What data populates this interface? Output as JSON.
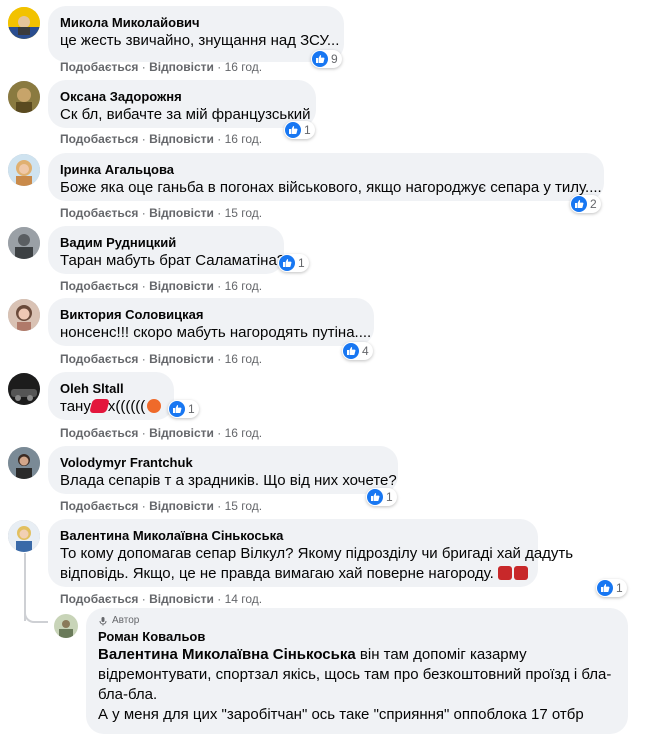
{
  "comments": [
    {
      "name": "Микола Миколайович",
      "text": "це жесть звичайно, знущання над ЗСУ...",
      "actions": {
        "like": "Подобається",
        "reply": "Відповісти",
        "time": "16 год."
      },
      "reactions": "9",
      "avatar_color": "#f2c200"
    },
    {
      "name": "Оксана Задорожня",
      "text": "Ск бл, вибачте за мій французський",
      "actions": {
        "like": "Подобається",
        "reply": "Відповісти",
        "time": "16 год."
      },
      "reactions": "1",
      "avatar_color": "#6b5a2a"
    },
    {
      "name": "Іринка Агальцова",
      "text": "Боже яка оце ганьба в погонах військового, якщо нагороджує сепара у тилу....",
      "actions": {
        "like": "Подобається",
        "reply": "Відповісти",
        "time": "15 год."
      },
      "reactions": "2",
      "avatar_color": "#d9b26a"
    },
    {
      "name": "Вадим Рудницкий",
      "text": "Таран мабуть брат Саламатіна?",
      "actions": {
        "like": "Подобається",
        "reply": "Відповісти",
        "time": "16 год."
      },
      "reactions": "1",
      "avatar_color": "#7a7d80"
    },
    {
      "name": "Виктория Соловицкая",
      "text": "нонсенс!!! скоро мабуть нагородять путіна....",
      "actions": {
        "like": "Подобається",
        "reply": "Відповісти",
        "time": "16 год."
      },
      "reactions": "4",
      "avatar_color": "#e8b9a7"
    },
    {
      "name": "Oleh Sltall",
      "text_before": "тану",
      "text_after": "х((((((",
      "actions": {
        "like": "Подобається",
        "reply": "Відповісти",
        "time": "16 год."
      },
      "reactions": "1",
      "avatar_color": "#222222"
    },
    {
      "name": "Volodymyr Frantchuk",
      "text": "Влада сепарів т а зрадників. Що від них хочете?",
      "actions": {
        "like": "Подобається",
        "reply": "Відповісти",
        "time": "15 год."
      },
      "reactions": "1",
      "avatar_color": "#5a5048"
    },
    {
      "name": "Валентина Миколаївна Сінькоська",
      "text_line1": "То кому допомагав сепар Вілкул? Якому підрозділу чи бригаді хай дадуть",
      "text_line2": "відповідь. Якщо, це не правда вимагаю хай поверне нагороду.",
      "actions": {
        "like": "Подобається",
        "reply": "Відповісти",
        "time": "14 год."
      },
      "reactions": "1",
      "avatar_color": "#e0c060"
    }
  ],
  "reply": {
    "badge": "Автор",
    "name": "Роман Ковальов",
    "mention": "Валентина Миколаївна Сінькоська",
    "line1_rest": " він там допоміг казарму",
    "line2": "відремонтувати, спортзал якісь, щось там про безкоштовний проїзд і бла-",
    "line3": "бла-бла.",
    "line4": "А у меня для цих \"заробітчан\" ось таке \"сприяння\" оппоблока 17 отбр",
    "avatar_color": "#b8c4a8"
  },
  "colors": {
    "accent": "#1877f2",
    "bubble": "#f0f2f5",
    "meta": "#65676b"
  }
}
